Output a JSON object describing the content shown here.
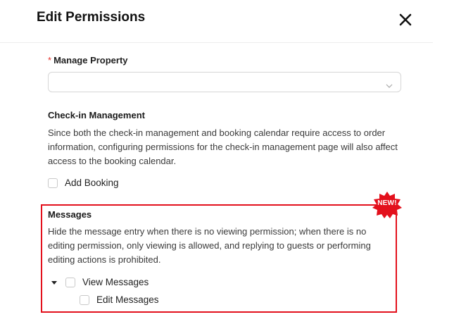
{
  "dialog": {
    "title": "Edit Permissions"
  },
  "manage_property": {
    "required_mark": "*",
    "label": "Manage Property",
    "value": ""
  },
  "checkin": {
    "title": "Check-in Management",
    "description": "Since both the check-in management and booking calendar require access to order information, configuring permissions for the check-in management page will also affect access to the booking calendar.",
    "add_booking_label": "Add Booking"
  },
  "messages": {
    "badge": "NEW!",
    "title": "Messages",
    "description": "Hide the message entry when there is no viewing permission; when there is no editing permission, only viewing is allowed, and replying to guests or performing editing actions is prohibited.",
    "view_label": "View Messages",
    "edit_label": "Edit Messages"
  },
  "colors": {
    "required": "#e5312b",
    "highlight": "#e3101c"
  }
}
